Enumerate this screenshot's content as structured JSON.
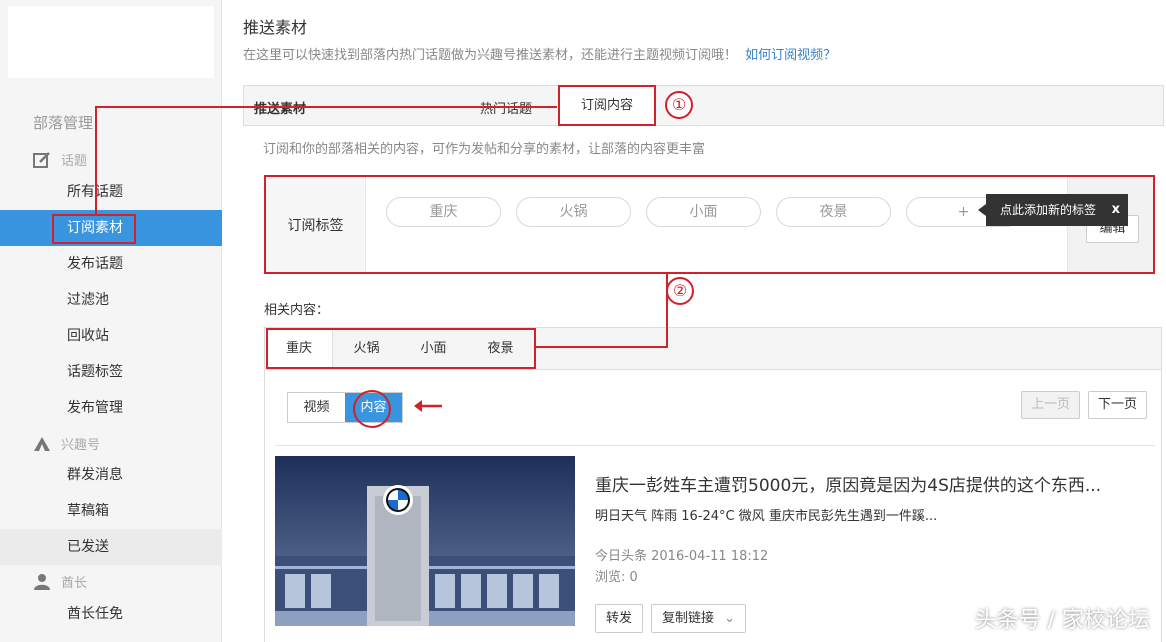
{
  "sidebar": {
    "section_title": "部落管理",
    "groups": [
      {
        "label": "话题",
        "icon": "edit-icon"
      },
      {
        "label": "兴趣号",
        "icon": "group-icon"
      },
      {
        "label": "酋长",
        "icon": "user-icon"
      }
    ],
    "items": [
      {
        "label": "所有话题"
      },
      {
        "label": "订阅素材"
      },
      {
        "label": "发布话题"
      },
      {
        "label": "过滤池"
      },
      {
        "label": "回收站"
      },
      {
        "label": "话题标签"
      },
      {
        "label": "发布管理"
      },
      {
        "label": "群发消息"
      },
      {
        "label": "草稿箱"
      },
      {
        "label": "已发送"
      },
      {
        "label": "酋长任免"
      }
    ]
  },
  "header": {
    "title": "推送素材",
    "description": "在这里可以快速找到部落内热门话题做为兴趣号推送素材，还能进行主题视频订阅哦！",
    "help_link": "如何订阅视频？"
  },
  "tabs_bar": {
    "label": "推送素材",
    "tabs": [
      "热门话题",
      "订阅内容"
    ],
    "active": "订阅内容"
  },
  "subscribe": {
    "description": "订阅和你的部落相关的内容，可作为发帖和分享的素材，让部落的内容更丰富",
    "tags_label": "订阅标签",
    "tags": [
      "重庆",
      "火锅",
      "小面",
      "夜景"
    ],
    "add_label": "+",
    "tooltip": "点此添加新的标签",
    "tooltip_close": "x",
    "edit_label": "编辑"
  },
  "related": {
    "label": "相关内容：",
    "tabs": [
      "重庆",
      "火锅",
      "小面",
      "夜景"
    ],
    "active_tab": "重庆",
    "type_switch": [
      "视频",
      "内容"
    ],
    "active_type": "内容",
    "prev_label": "上一页",
    "next_label": "下一页",
    "article": {
      "title": "重庆一彭姓车主遭罚5000元，原因竟是因为4S店提供的这个东西...",
      "summary": "明日天气 阵雨 16-24°C 微风 重庆市民彭先生遇到一件蹊...",
      "meta": "今日头条 2016-04-11 18:12",
      "views": "浏览: 0",
      "forward_label": "转发",
      "copy_link_label": "复制链接"
    }
  },
  "annotations": {
    "step1": "①",
    "step2": "②"
  },
  "watermark": "头条号 / 家校论坛",
  "colors": {
    "accent": "#3a95e0",
    "annotation": "#d0222a"
  }
}
